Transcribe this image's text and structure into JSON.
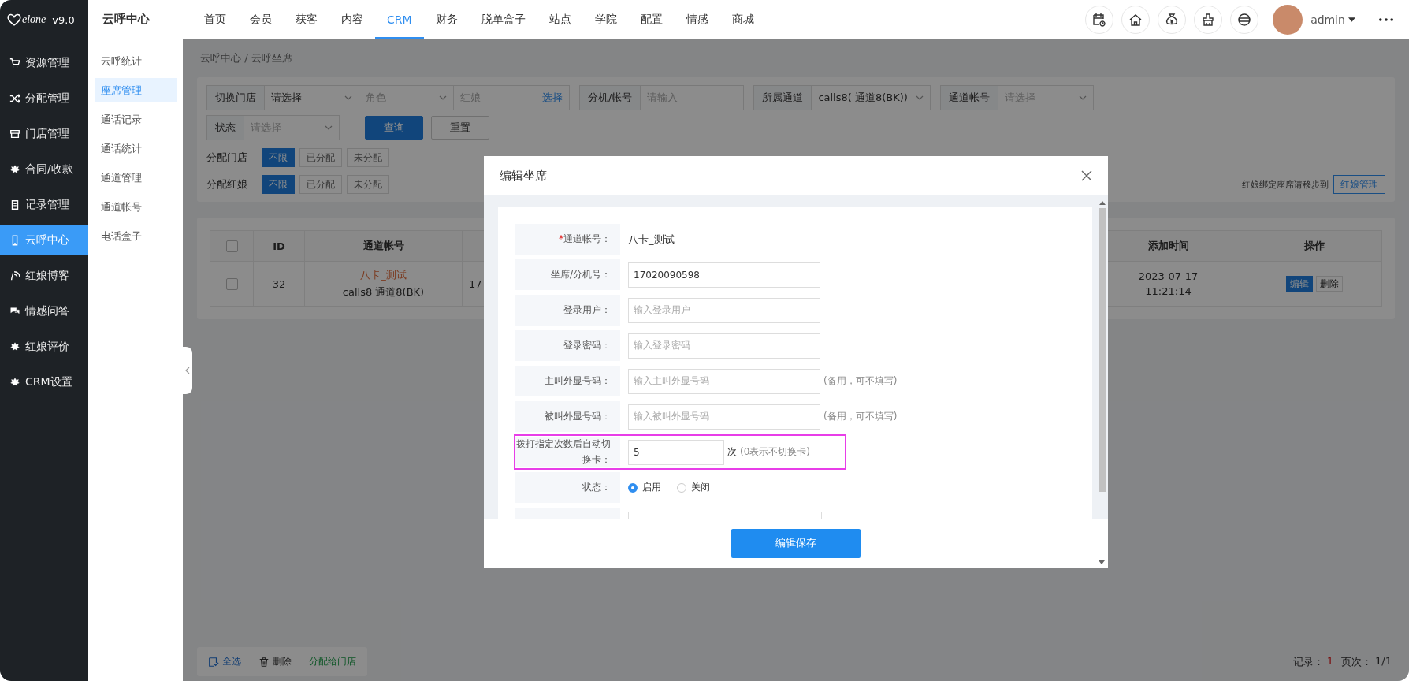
{
  "logo": {
    "text": "elone",
    "version": "v9.0"
  },
  "module_title": "云呼中心",
  "nav": [
    {
      "label": "首页",
      "selected": false
    },
    {
      "label": "会员",
      "selected": false
    },
    {
      "label": "获客",
      "selected": false
    },
    {
      "label": "内容",
      "selected": false
    },
    {
      "label": "CRM",
      "selected": true
    },
    {
      "label": "财务",
      "selected": false
    },
    {
      "label": "脱单盒子",
      "selected": false
    },
    {
      "label": "站点",
      "selected": false
    },
    {
      "label": "学院",
      "selected": false
    },
    {
      "label": "配置",
      "selected": false
    },
    {
      "label": "情感",
      "selected": false
    },
    {
      "label": "商城",
      "selected": false
    }
  ],
  "user": {
    "name": "admin"
  },
  "sidebar": [
    {
      "label": "资源管理",
      "selected": false
    },
    {
      "label": "分配管理",
      "selected": false
    },
    {
      "label": "门店管理",
      "selected": false
    },
    {
      "label": "合同/收款",
      "selected": false
    },
    {
      "label": "记录管理",
      "selected": false
    },
    {
      "label": "云呼中心",
      "selected": true
    },
    {
      "label": "红娘博客",
      "selected": false
    },
    {
      "label": "情感问答",
      "selected": false
    },
    {
      "label": "红娘评价",
      "selected": false
    },
    {
      "label": "CRM设置",
      "selected": false
    }
  ],
  "submenu": [
    {
      "label": "云呼统计",
      "selected": false
    },
    {
      "label": "座席管理",
      "selected": true
    },
    {
      "label": "通话记录",
      "selected": false
    },
    {
      "label": "通话统计",
      "selected": false
    },
    {
      "label": "通道管理",
      "selected": false
    },
    {
      "label": "通道帐号",
      "selected": false
    },
    {
      "label": "电话盒子",
      "selected": false
    }
  ],
  "breadcrumb": "云呼中心 / 云呼坐席",
  "filter_rows": [
    [
      {
        "label": "切换门店",
        "controls": [
          {
            "kind": "select",
            "value": "请选择"
          },
          {
            "kind": "select",
            "placeholder": "角色"
          },
          {
            "kind": "picker",
            "placeholder": "红娘",
            "action": "选择"
          }
        ]
      },
      {
        "label": "分机/帐号",
        "controls": [
          {
            "kind": "input",
            "placeholder": "请输入"
          }
        ]
      },
      {
        "label": "所属通道",
        "controls": [
          {
            "kind": "select",
            "value": "calls8( 通道8(BK))"
          }
        ]
      },
      {
        "label": "通道帐号",
        "controls": [
          {
            "kind": "select",
            "placeholder": "请选择"
          }
        ]
      }
    ],
    [
      {
        "label": "状态",
        "controls": [
          {
            "kind": "select",
            "placeholder": "请选择"
          }
        ]
      }
    ]
  ],
  "filter_buttons": [
    {
      "label": "查询",
      "primary": true
    },
    {
      "label": "重置",
      "primary": false
    }
  ],
  "segments": [
    {
      "label": "分配门店",
      "options": [
        {
          "label": "不限",
          "selected": true
        },
        {
          "label": "已分配",
          "selected": false
        },
        {
          "label": "未分配",
          "selected": false
        }
      ]
    },
    {
      "label": "分配红娘",
      "options": [
        {
          "label": "不限",
          "selected": true
        },
        {
          "label": "已分配",
          "selected": false
        },
        {
          "label": "未分配",
          "selected": false
        }
      ]
    }
  ],
  "hint": {
    "text": "红娘绑定座席请移步到",
    "button": "红娘管理"
  },
  "table": {
    "header_checked": false,
    "header": {
      "id": "ID",
      "account": "通道帐号",
      "added": "添加时间",
      "actions": "操作"
    },
    "rows": [
      {
        "checked": false,
        "id": "32",
        "account": "八卡_测试",
        "channel": "calls8 通道8(BK)",
        "column_4": "17",
        "added_date": "2023-07-17",
        "added_time": "11:21:14",
        "actions": [
          {
            "label": "编辑",
            "primary": true
          },
          {
            "label": "删除",
            "primary": false
          }
        ]
      }
    ]
  },
  "bottom_actions": [
    {
      "kind": "select_all",
      "label": "全选"
    },
    {
      "kind": "delete",
      "label": "删除"
    },
    {
      "kind": "assign",
      "label": "分配给门店"
    }
  ],
  "pager": {
    "records_label": "记录：",
    "records": "1",
    "page_label": "页次：",
    "page": "1/1"
  },
  "dialog": {
    "title": "编辑坐席",
    "fields": [
      {
        "kind": "text",
        "mark": "*",
        "label": "通道帐号：",
        "highlighted": false,
        "value": "八卡_测试"
      },
      {
        "kind": "input",
        "label": "坐席/分机号：",
        "highlighted": false,
        "value": "17020090598"
      },
      {
        "kind": "input",
        "label": "登录用户：",
        "highlighted": false,
        "placeholder": "输入登录用户"
      },
      {
        "kind": "input",
        "label": "登录密码：",
        "highlighted": false,
        "placeholder": "输入登录密码"
      },
      {
        "kind": "input",
        "label": "主叫外显号码：",
        "highlighted": false,
        "placeholder": "输入主叫外显号码",
        "note": "(备用，可不填写)"
      },
      {
        "kind": "input",
        "label": "被叫外显号码：",
        "highlighted": false,
        "placeholder": "输入被叫外显号码",
        "note": "(备用，可不填写)"
      },
      {
        "kind": "short_input",
        "label": "拨打指定次数后自动切换卡：",
        "highlighted": true,
        "value": "5",
        "unit": "次",
        "note": "(0表示不切换卡)"
      },
      {
        "kind": "radio",
        "label": "状态：",
        "highlighted": false,
        "options": [
          {
            "label": "启用",
            "selected": true
          },
          {
            "label": "关闭",
            "selected": false
          }
        ]
      },
      {
        "kind": "textarea"
      }
    ],
    "save_button": "编辑保存"
  }
}
